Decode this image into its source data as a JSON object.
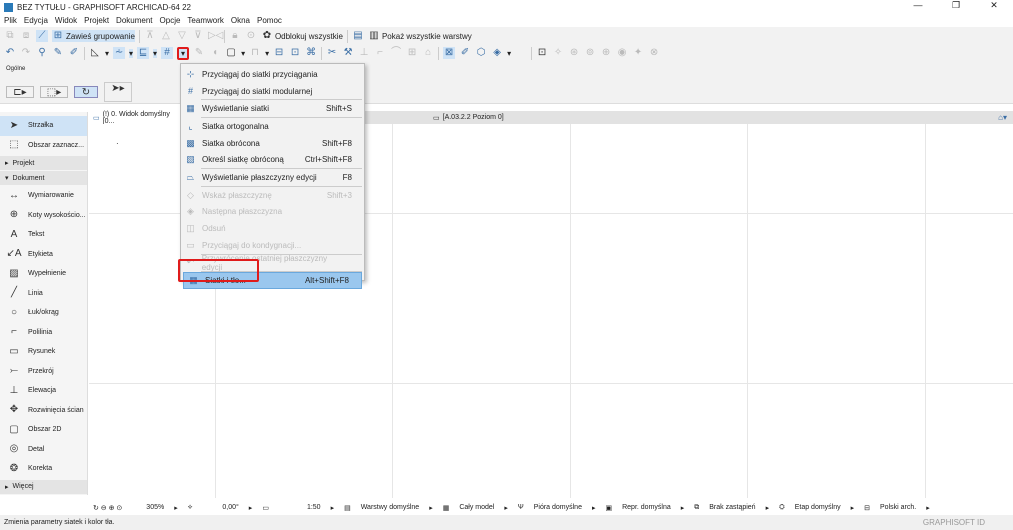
{
  "window": {
    "title": "BEZ TYTUŁU - GRAPHISOFT ARCHICAD-64 22"
  },
  "menubar": [
    "Plik",
    "Edycja",
    "Widok",
    "Projekt",
    "Dokument",
    "Opcje",
    "Teamwork",
    "Okna",
    "Pomoc"
  ],
  "toolbar1": {
    "suspend_groups": "Zawieś grupowanie",
    "unlock_all": "Odblokuj wszystkie",
    "show_all_layers": "Pokaż wszystkie warstwy"
  },
  "infobox": {
    "label": "Ogólne"
  },
  "sidebar": {
    "items_top": [
      "Strzałka",
      "Obszar zaznacz..."
    ],
    "group_project": "Projekt",
    "group_document": "Dokument",
    "items": [
      {
        "label": "Wymiarowanie",
        "icon": "dimension-icon",
        "glyph": "↔"
      },
      {
        "label": "Koty wysokościo...",
        "icon": "level-dimension-icon",
        "glyph": "⊕"
      },
      {
        "label": "Tekst",
        "icon": "text-icon",
        "glyph": "A"
      },
      {
        "label": "Etykieta",
        "icon": "label-icon",
        "glyph": "↙A"
      },
      {
        "label": "Wypełnienie",
        "icon": "fill-icon",
        "glyph": "▨"
      },
      {
        "label": "Linia",
        "icon": "line-icon",
        "glyph": "╱"
      },
      {
        "label": "Łuk/okrąg",
        "icon": "arc-icon",
        "glyph": "○"
      },
      {
        "label": "Polilinia",
        "icon": "polyline-icon",
        "glyph": "⌐"
      },
      {
        "label": "Rysunek",
        "icon": "drawing-icon",
        "glyph": "▭"
      },
      {
        "label": "Przekrój",
        "icon": "section-icon",
        "glyph": "⤚"
      },
      {
        "label": "Elewacja",
        "icon": "elevation-icon",
        "glyph": "⊥"
      },
      {
        "label": "Rozwinięcia ścian",
        "icon": "interior-elevation-icon",
        "glyph": "✥"
      },
      {
        "label": "Obszar 2D",
        "icon": "worksheet-icon",
        "glyph": "▢"
      },
      {
        "label": "Detal",
        "icon": "detail-icon",
        "glyph": "◎"
      },
      {
        "label": "Korekta",
        "icon": "change-icon",
        "glyph": "❂"
      }
    ],
    "more": "Więcej"
  },
  "tabs": [
    {
      "label": "(!) 0. Widok domyślny [0..."
    },
    {
      "label": "[A.03.2.2 Poziom 0]"
    }
  ],
  "menu": {
    "items": [
      {
        "label": "Przyciągaj do siatki przyciągania",
        "shortcut": "",
        "glyph": "⊹",
        "disabled": false
      },
      {
        "label": "Przyciągaj do siatki modularnej",
        "shortcut": "",
        "glyph": "#",
        "disabled": false
      },
      {
        "label": "Wyświetlanie siatki",
        "shortcut": "Shift+S",
        "glyph": "▦",
        "disabled": false,
        "sep_before": true
      },
      {
        "label": "Siatka ortogonalna",
        "shortcut": "",
        "glyph": "⌞",
        "disabled": false,
        "sep_before": true
      },
      {
        "label": "Siatka obrócona",
        "shortcut": "Shift+F8",
        "glyph": "▩",
        "disabled": false
      },
      {
        "label": "Określ siatkę obróconą",
        "shortcut": "Ctrl+Shift+F8",
        "glyph": "▧",
        "disabled": false
      },
      {
        "label": "Wyświetlanie płaszczyzny edycji",
        "shortcut": "F8",
        "glyph": "⏢",
        "disabled": false,
        "sep_before": true
      },
      {
        "label": "Wskaż płaszczyznę",
        "shortcut": "Shift+3",
        "glyph": "◇",
        "disabled": true,
        "sep_before": true
      },
      {
        "label": "Następna płaszczyzna",
        "shortcut": "",
        "glyph": "◈",
        "disabled": true
      },
      {
        "label": "Odsuń",
        "shortcut": "",
        "glyph": "◫",
        "disabled": true
      },
      {
        "label": "Przyciągaj do kondygnacji...",
        "shortcut": "",
        "glyph": "▭",
        "disabled": true
      },
      {
        "label": "Przywrócenie ostatniej płaszczyzny edycji",
        "shortcut": "",
        "glyph": "↶",
        "disabled": true,
        "sep_before": true
      },
      {
        "label": "Siatki i tło...",
        "shortcut": "Alt+Shift+F8",
        "glyph": "▦",
        "disabled": false,
        "highlighted": true,
        "sep_before": true
      }
    ]
  },
  "statusbar": {
    "zoom": "305%",
    "angle": "0,00°",
    "scale": "1:50",
    "layers": "Warstwy domyślne",
    "model": "Cały model",
    "pens": "Pióra domyślne",
    "repr": "Repr. domyślna",
    "override": "Brak zastąpień",
    "phase": "Etap domyślny",
    "dim": "Polski arch."
  },
  "hint": {
    "text": "Zmienia parametry siatek i kolor tła.",
    "brand": "GRAPHISOFT ID"
  }
}
